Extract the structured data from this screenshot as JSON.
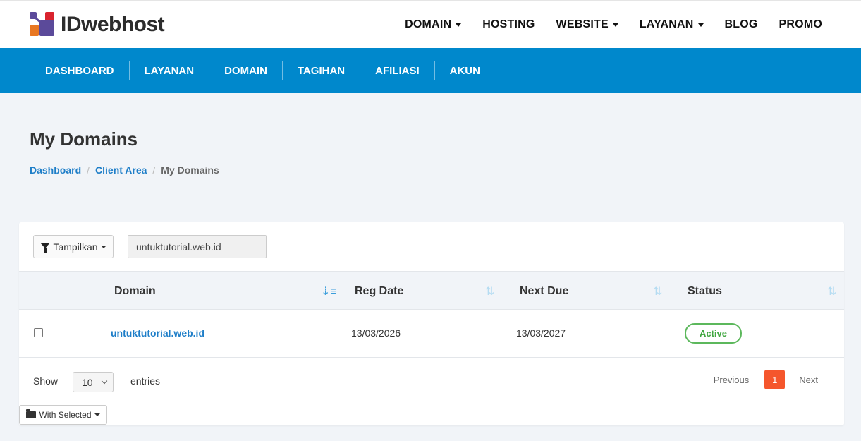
{
  "brand": {
    "name": "IDwebhost"
  },
  "top_nav": [
    {
      "label": "DOMAIN",
      "dropdown": true
    },
    {
      "label": "HOSTING",
      "dropdown": false
    },
    {
      "label": "WEBSITE",
      "dropdown": true
    },
    {
      "label": "LAYANAN",
      "dropdown": true
    },
    {
      "label": "BLOG",
      "dropdown": false
    },
    {
      "label": "PROMO",
      "dropdown": false
    }
  ],
  "client_nav": [
    "DASHBOARD",
    "LAYANAN",
    "DOMAIN",
    "TAGIHAN",
    "AFILIASI",
    "AKUN"
  ],
  "page": {
    "title": "My Domains",
    "breadcrumb": [
      "Dashboard",
      "Client Area",
      "My Domains"
    ],
    "breadcrumb_separator": "/"
  },
  "toolbar": {
    "filter_label": "Tampilkan",
    "search_value": "untuktutorial.web.id"
  },
  "table": {
    "columns": [
      "Domain",
      "Reg Date",
      "Next Due",
      "Status"
    ],
    "rows": [
      {
        "domain": "untuktutorial.web.id",
        "reg_date": "13/03/2026",
        "next_due": "13/03/2027",
        "status": "Active"
      }
    ]
  },
  "footer": {
    "show_label": "Show",
    "page_size": "10",
    "entries_label": "entries",
    "prev_label": "Previous",
    "current_page": "1",
    "next_label": "Next",
    "bulk_label": "With Selected"
  },
  "colors": {
    "primary_blue": "#0088cc",
    "link_blue": "#1e7ec8",
    "active_green": "#5cb85c",
    "page_active": "#f5562c"
  },
  "icons": {
    "filter": "filter-icon",
    "sort_active": "sort-amount-down-icon",
    "sort": "sort-icon",
    "folder": "folder-open-icon"
  }
}
